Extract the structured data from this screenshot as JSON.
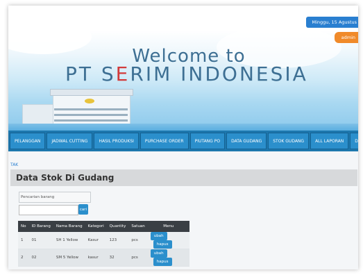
{
  "header": {
    "date": "Minggu, 15 Agustus",
    "user": "admin",
    "welcome": "Welcome to",
    "company_prefix": "PT S",
    "company_accent": "E",
    "company_suffix": "RIM INDONESIA"
  },
  "nav": [
    {
      "label": "PELANGGAN"
    },
    {
      "label": "JADWAL CUTTING"
    },
    {
      "label": "HASIL PRODUKSI"
    },
    {
      "label": "PURCHASE ORDER"
    },
    {
      "label": "PIUTANG PO"
    },
    {
      "label": "DATA GUDANG"
    },
    {
      "label": "STOK GUDANG"
    },
    {
      "label": "ALL LAPORAN"
    },
    {
      "label": "DATA AKUN"
    }
  ],
  "breadcrumb": "TAK",
  "page_title": "Data Stok Di Gudang",
  "search": {
    "label": "Pencarian barang",
    "value": "",
    "button": "cari"
  },
  "table": {
    "headers": [
      "No",
      "ID Barang",
      "Nama Barang",
      "Kategori",
      "Quantity",
      "Satuan",
      "Menu"
    ],
    "rows": [
      {
        "no": "1",
        "id": "01",
        "nama": "SH 1 Yellow",
        "kategori": "Kasur",
        "quantity": "123",
        "satuan": "pcs"
      },
      {
        "no": "2",
        "id": "02",
        "nama": "SM 5 Yellow",
        "kategori": "kasur",
        "quantity": "32",
        "satuan": "pcs"
      }
    ],
    "edit_label": "ubah",
    "delete_label": "hapus"
  },
  "colors": {
    "nav_bg": "#1d77ad",
    "button_blue": "#2b8fcc",
    "accent_red": "#d23a3a",
    "admin_orange": "#f08a2a"
  }
}
